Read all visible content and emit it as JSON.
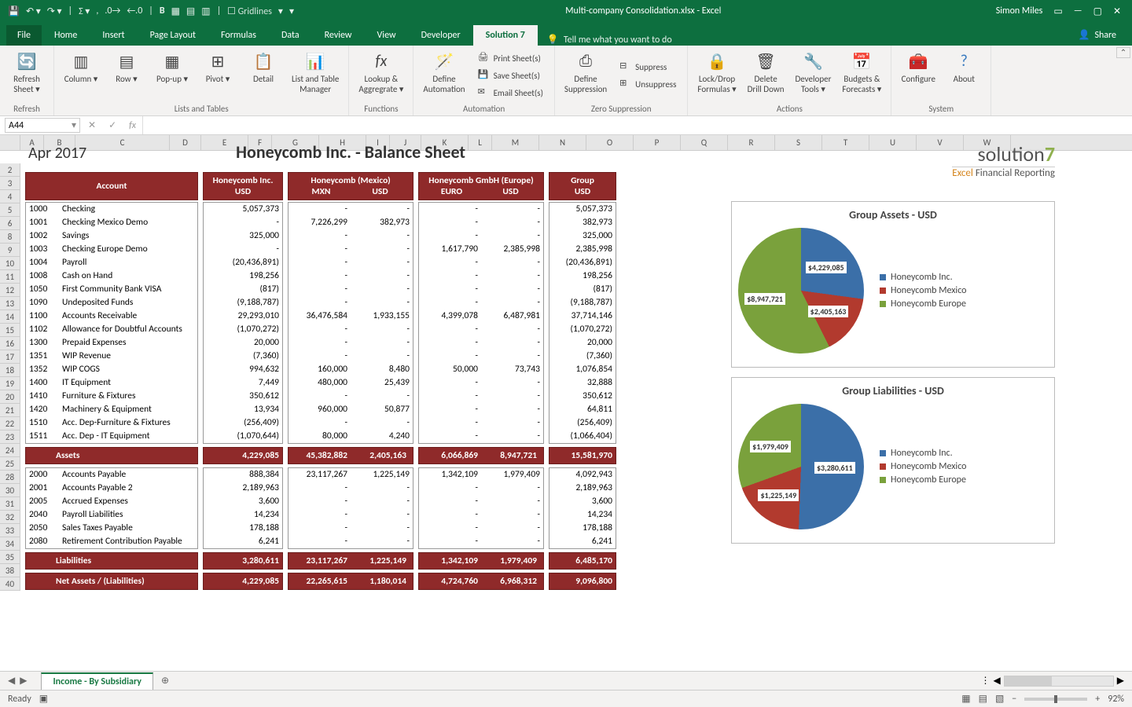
{
  "titlebar": {
    "filename": "Multi-company Consolidation.xlsx - Excel",
    "username": "Simon Miles"
  },
  "menu": {
    "file": "File",
    "tabs": [
      "Home",
      "Insert",
      "Page Layout",
      "Formulas",
      "Data",
      "Review",
      "View",
      "Developer",
      "Solution 7"
    ],
    "active": "Solution 7",
    "tell": "Tell me what you want to do",
    "share": "Share"
  },
  "qat": {
    "gridlines": "Gridlines"
  },
  "ribbon": {
    "refresh": {
      "label": "Refresh\nSheet ▾",
      "group": "Refresh"
    },
    "lists": {
      "column": "Column ▾",
      "row": "Row ▾",
      "popup": "Pop-up ▾",
      "pivot": "Pivot ▾",
      "detail": "Detail",
      "ltm": "List and Table\nManager",
      "group": "Lists and Tables"
    },
    "functions": {
      "lookup": "Lookup &\nAggregrate ▾",
      "group": "Functions"
    },
    "automation": {
      "define": "Define\nAutomation",
      "print": "Print Sheet(s)",
      "save": "Save Sheet(s)",
      "email": "Email Sheet(s)",
      "group": "Automation"
    },
    "zero": {
      "define": "Define\nSuppression",
      "suppress": "Suppress",
      "unsuppress": "Unsuppress",
      "group": "Zero Suppression"
    },
    "actions": {
      "lock": "Lock/Drop\nFormulas ▾",
      "delete": "Delete\nDrill Down",
      "dev": "Developer\nTools ▾",
      "budget": "Budgets &\nForecasts ▾",
      "group": "Actions"
    },
    "system": {
      "conf": "Configure",
      "about": "About",
      "group": "System"
    }
  },
  "namebox": "A44",
  "report": {
    "period": "Apr 2017",
    "title": "Honeycomb Inc. - Balance Sheet",
    "logo1a": "solution",
    "logo1b": "7",
    "logo2a": "Excel",
    "logo2b": " Financial Reporting",
    "headers": {
      "account": "Account",
      "c1": "Honeycomb Inc.",
      "c1u": "USD",
      "c2": "Honeycomb (Mexico)",
      "c2a": "MXN",
      "c2b": "USD",
      "c3": "Honeycomb GmbH (Europe)",
      "c3a": "EURO",
      "c3b": "USD",
      "cg": "Group",
      "cgu": "USD"
    },
    "assets": [
      {
        "code": "1000",
        "name": "Checking",
        "c1": "5,057,373",
        "c2a": "-",
        "c2b": "-",
        "c3a": "-",
        "c3b": "-",
        "g": "5,057,373"
      },
      {
        "code": "1001",
        "name": "Checking Mexico Demo",
        "c1": "-",
        "c2a": "7,226,299",
        "c2b": "382,973",
        "c3a": "-",
        "c3b": "-",
        "g": "382,973"
      },
      {
        "code": "1002",
        "name": "Savings",
        "c1": "325,000",
        "c2a": "-",
        "c2b": "-",
        "c3a": "-",
        "c3b": "-",
        "g": "325,000"
      },
      {
        "code": "1003",
        "name": "Checking Europe Demo",
        "c1": "-",
        "c2a": "-",
        "c2b": "-",
        "c3a": "1,617,790",
        "c3b": "2,385,998",
        "g": "2,385,998"
      },
      {
        "code": "1004",
        "name": "Payroll",
        "c1": "(20,436,891)",
        "c2a": "-",
        "c2b": "-",
        "c3a": "-",
        "c3b": "-",
        "g": "(20,436,891)"
      },
      {
        "code": "1008",
        "name": "Cash on Hand",
        "c1": "198,256",
        "c2a": "-",
        "c2b": "-",
        "c3a": "-",
        "c3b": "-",
        "g": "198,256"
      },
      {
        "code": "1050",
        "name": "First Community Bank VISA",
        "c1": "(817)",
        "c2a": "-",
        "c2b": "-",
        "c3a": "-",
        "c3b": "-",
        "g": "(817)"
      },
      {
        "code": "1090",
        "name": "Undeposited Funds",
        "c1": "(9,188,787)",
        "c2a": "-",
        "c2b": "-",
        "c3a": "-",
        "c3b": "-",
        "g": "(9,188,787)"
      },
      {
        "code": "1100",
        "name": "Accounts Receivable",
        "c1": "29,293,010",
        "c2a": "36,476,584",
        "c2b": "1,933,155",
        "c3a": "4,399,078",
        "c3b": "6,487,981",
        "g": "37,714,146"
      },
      {
        "code": "1102",
        "name": "Allowance for Doubtful Accounts",
        "c1": "(1,070,272)",
        "c2a": "-",
        "c2b": "-",
        "c3a": "-",
        "c3b": "-",
        "g": "(1,070,272)"
      },
      {
        "code": "1300",
        "name": "Prepaid Expenses",
        "c1": "20,000",
        "c2a": "-",
        "c2b": "-",
        "c3a": "-",
        "c3b": "-",
        "g": "20,000"
      },
      {
        "code": "1351",
        "name": "WIP Revenue",
        "c1": "(7,360)",
        "c2a": "-",
        "c2b": "-",
        "c3a": "-",
        "c3b": "-",
        "g": "(7,360)"
      },
      {
        "code": "1352",
        "name": "WIP COGS",
        "c1": "994,632",
        "c2a": "160,000",
        "c2b": "8,480",
        "c3a": "50,000",
        "c3b": "73,743",
        "g": "1,076,854"
      },
      {
        "code": "1400",
        "name": "IT Equipment",
        "c1": "7,449",
        "c2a": "480,000",
        "c2b": "25,439",
        "c3a": "-",
        "c3b": "-",
        "g": "32,888"
      },
      {
        "code": "1410",
        "name": "Furniture & Fixtures",
        "c1": "350,612",
        "c2a": "-",
        "c2b": "-",
        "c3a": "-",
        "c3b": "-",
        "g": "350,612"
      },
      {
        "code": "1420",
        "name": "Machinery & Equipment",
        "c1": "13,934",
        "c2a": "960,000",
        "c2b": "50,877",
        "c3a": "-",
        "c3b": "-",
        "g": "64,811"
      },
      {
        "code": "1510",
        "name": "Acc. Dep-Furniture & Fixtures",
        "c1": "(256,409)",
        "c2a": "-",
        "c2b": "-",
        "c3a": "-",
        "c3b": "-",
        "g": "(256,409)"
      },
      {
        "code": "1511",
        "name": "Acc. Dep - IT Equipment",
        "c1": "(1,070,644)",
        "c2a": "80,000",
        "c2b": "4,240",
        "c3a": "-",
        "c3b": "-",
        "g": "(1,066,404)"
      }
    ],
    "assets_total": {
      "label": "Assets",
      "c1": "4,229,085",
      "c2a": "45,382,882",
      "c2b": "2,405,163",
      "c3a": "6,066,869",
      "c3b": "8,947,721",
      "g": "15,581,970"
    },
    "liabs": [
      {
        "code": "2000",
        "name": "Accounts Payable",
        "c1": "888,384",
        "c2a": "23,117,267",
        "c2b": "1,225,149",
        "c3a": "1,342,109",
        "c3b": "1,979,409",
        "g": "4,092,943"
      },
      {
        "code": "2001",
        "name": "Accounts Payable 2",
        "c1": "2,189,963",
        "c2a": "-",
        "c2b": "-",
        "c3a": "-",
        "c3b": "-",
        "g": "2,189,963"
      },
      {
        "code": "2005",
        "name": "Accrued Expenses",
        "c1": "3,600",
        "c2a": "-",
        "c2b": "-",
        "c3a": "-",
        "c3b": "-",
        "g": "3,600"
      },
      {
        "code": "2040",
        "name": "Payroll Liabilities",
        "c1": "14,234",
        "c2a": "-",
        "c2b": "-",
        "c3a": "-",
        "c3b": "-",
        "g": "14,234"
      },
      {
        "code": "2050",
        "name": "Sales Taxes Payable",
        "c1": "178,188",
        "c2a": "-",
        "c2b": "-",
        "c3a": "-",
        "c3b": "-",
        "g": "178,188"
      },
      {
        "code": "2080",
        "name": "Retirement Contribution Payable",
        "c1": "6,241",
        "c2a": "-",
        "c2b": "-",
        "c3a": "-",
        "c3b": "-",
        "g": "6,241"
      }
    ],
    "liabs_total": {
      "label": "Liabilities",
      "c1": "3,280,611",
      "c2a": "23,117,267",
      "c2b": "1,225,149",
      "c3a": "1,342,109",
      "c3b": "1,979,409",
      "g": "6,485,170"
    },
    "net": {
      "label": "Net Assets / (Liabilities)",
      "c1": "4,229,085",
      "c2a": "22,265,615",
      "c2b": "1,180,014",
      "c3a": "4,724,760",
      "c3b": "6,968,312",
      "g": "9,096,800"
    }
  },
  "chart_data": [
    {
      "type": "pie",
      "title": "Group Assets - USD",
      "categories": [
        "Honeycomb Inc.",
        "Honeycomb Mexico",
        "Honeycomb Europe"
      ],
      "values": [
        4229085,
        2405163,
        8947721
      ],
      "labels": [
        "$4,229,085",
        "$2,405,163",
        "$8,947,721"
      ],
      "colors": [
        "#3b6fa8",
        "#b23a2e",
        "#7aa13c"
      ]
    },
    {
      "type": "pie",
      "title": "Group Liabilities - USD",
      "categories": [
        "Honeycomb Inc.",
        "Honeycomb Mexico",
        "Honeycomb Europe"
      ],
      "values": [
        3280611,
        1225149,
        1979409
      ],
      "labels": [
        "$3,280,611",
        "$1,225,149",
        "$1,979,409"
      ],
      "colors": [
        "#3b6fa8",
        "#b23a2e",
        "#7aa13c"
      ]
    }
  ],
  "sheettab": "Income - By Subsidiary",
  "status": {
    "ready": "Ready",
    "zoom": "92%"
  },
  "cols": [
    "A",
    "B",
    "C",
    "D",
    "E",
    "F",
    "G",
    "H",
    "I",
    "J",
    "K",
    "L",
    "M",
    "N",
    "O",
    "P",
    "Q",
    "R",
    "S",
    "T",
    "U",
    "V",
    "W"
  ],
  "rows": [
    "2",
    "3",
    "4",
    "5",
    "6",
    "8",
    "9",
    "10",
    "11",
    "12",
    "13",
    "14",
    "15",
    "16",
    "17",
    "18",
    "19",
    "20",
    "21",
    "22",
    "23",
    "24",
    "25",
    "28",
    "30",
    "31",
    "32",
    "33",
    "34",
    "35",
    "38",
    "40"
  ]
}
